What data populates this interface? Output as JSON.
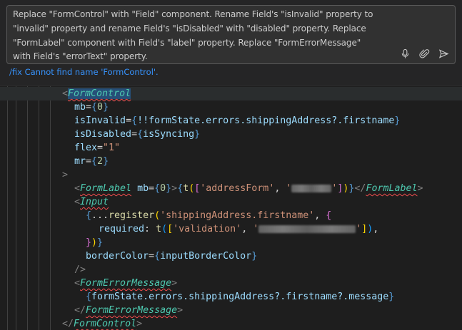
{
  "chat": {
    "prompt_lines": [
      "Replace \"FormControl\" with \"Field\" component. Rename Field's  \"isInvalid\" property to",
      "\"invalid\" property and rename Field's \"isDisabled\" with \"disabled\" property. Replace",
      "\"FormLabel\" component with Field's \"label\" property.  Replace \"FormErrorMessage\"",
      "with Field's \"errorText\" property."
    ],
    "status": "/fix Cannot find name 'FormControl'.",
    "icons": [
      "microphone-icon",
      "attach-icon",
      "send-icon"
    ]
  },
  "editor": {
    "tokens": {
      "form_control": "FormControl",
      "mb_attr": "mb",
      "mb_val": "0",
      "is_invalid_attr": "isInvalid",
      "is_invalid_expr": "!!formState.errors.shippingAddress?.firstname",
      "is_disabled_attr": "isDisabled",
      "is_syncing": "isSyncing",
      "flex_attr": "flex",
      "flex_val": "\"1\"",
      "mr_attr": "mr",
      "mr_val": "2",
      "form_label": "FormLabel",
      "t_fn": "t",
      "address_form": "'addressForm'",
      "input_tag": "Input",
      "spread": "...",
      "register_fn": "register",
      "register_arg": "'shippingAddress.firstname'",
      "required_key": "required",
      "validation": "'validation'",
      "border_color_attr": "borderColor",
      "input_border_color": "inputBorderColor",
      "form_error_message": "FormErrorMessage",
      "message_expr": "formState.errors.shippingAddress?.firstname?.message"
    },
    "colors": {
      "tag": "#4ec9b0",
      "attr": "#9cdcfe",
      "string": "#ce9178",
      "brace": "#569cd6",
      "function": "#dcdcaa",
      "error_squiggle": "#f14c4c"
    }
  }
}
